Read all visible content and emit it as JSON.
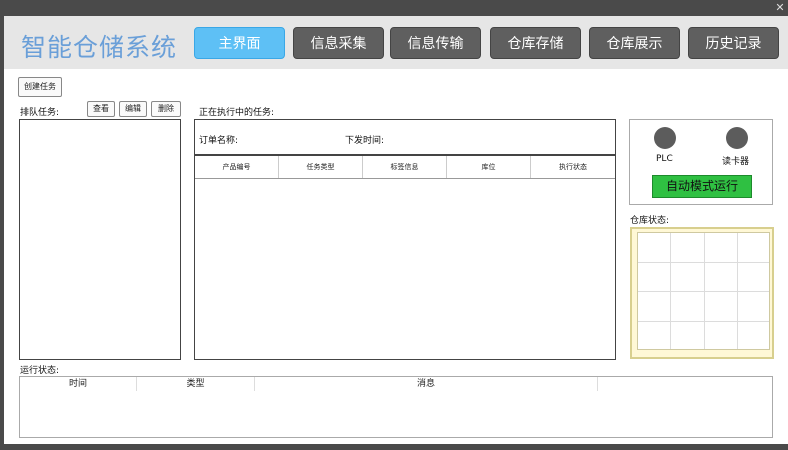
{
  "app": {
    "title": "智能仓储系统",
    "close_glyph": "✕"
  },
  "nav": [
    {
      "label": "主界面",
      "active": true
    },
    {
      "label": "信息采集"
    },
    {
      "label": "信息传输"
    },
    {
      "label": "仓库存储"
    },
    {
      "label": "仓库展示"
    },
    {
      "label": "历史记录"
    }
  ],
  "toolbar": {
    "create_task": "创建任务"
  },
  "queue": {
    "label": "排队任务:",
    "view": "查看",
    "edit": "编辑",
    "delete": "删除"
  },
  "current": {
    "label": "正在执行中的任务:",
    "order_name_label": "订单名称:",
    "issue_time_label": "下发时间:",
    "columns": [
      "产品编号",
      "任务类型",
      "标签信息",
      "库位",
      "执行状态"
    ]
  },
  "devices": {
    "plc": "PLC",
    "reader": "读卡器",
    "auto_mode": "自动模式运行",
    "indicator_color": "#5c5c5c",
    "run_color": "#2fc042"
  },
  "warehouse": {
    "label": "仓库状态:"
  },
  "log": {
    "label": "运行状态:",
    "columns": [
      "时间",
      "类型",
      "消息",
      ""
    ]
  },
  "colors": {
    "accent": "#5ec0f5",
    "title": "#6a9fd8",
    "nav_bg": "#5f5f5f"
  }
}
